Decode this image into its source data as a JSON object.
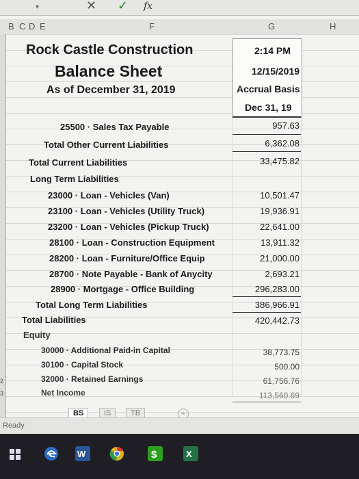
{
  "formula_bar": {
    "fx": "fx"
  },
  "columns": [
    "B",
    "C",
    "D",
    "E",
    "F",
    "G",
    "H"
  ],
  "report": {
    "company": "Rock Castle Construction",
    "title": "Balance Sheet",
    "as_of": "As of December 31, 2019",
    "time": "2:14 PM",
    "date": "12/15/2019",
    "basis": "Accrual Basis",
    "column_header": "Dec 31, 19"
  },
  "rows": [
    {
      "label": "25500 · Sales Tax Payable",
      "value": "957.63"
    },
    {
      "label": "Total Other Current Liabilities",
      "value": "6,362.08"
    },
    {
      "label": "Total Current Liabilities",
      "value": "33,475.82"
    },
    {
      "label": "Long Term Liabilities",
      "value": ""
    },
    {
      "label": "23000 · Loan - Vehicles (Van)",
      "value": "10,501.47"
    },
    {
      "label": "23100 · Loan - Vehicles (Utility Truck)",
      "value": "19,936.91"
    },
    {
      "label": "23200 · Loan - Vehicles (Pickup Truck)",
      "value": "22,641.00"
    },
    {
      "label": "28100 · Loan - Construction Equipment",
      "value": "13,911.32"
    },
    {
      "label": "28200 · Loan - Furniture/Office Equip",
      "value": "21,000.00"
    },
    {
      "label": "28700 · Note Payable - Bank of Anycity",
      "value": "2,693.21"
    },
    {
      "label": "28900 · Mortgage - Office Building",
      "value": "296,283.00"
    },
    {
      "label": "Total Long Term Liabilities",
      "value": "386,966.91"
    },
    {
      "label": "Total Liabilities",
      "value": "420,442.73"
    },
    {
      "label": "Equity",
      "value": ""
    },
    {
      "label": "30000 · Additional Paid-in Capital",
      "value": "38,773.75"
    },
    {
      "label": "30100 · Capital Stock",
      "value": "500.00"
    },
    {
      "label": "32000 · Retained Earnings",
      "value": "61,756.76"
    },
    {
      "label": "Net Income",
      "value": "113,560.69"
    }
  ],
  "row_numbers": [
    "2",
    "3"
  ],
  "sheet_tabs": [
    "BS",
    "IS",
    "TB"
  ],
  "status": "Ready",
  "colors": {
    "taskbar": "#1e1e24",
    "edge_blue": "#2b6cc4",
    "word_blue": "#2a5699",
    "chrome": "#e0b020",
    "quickbooks_green": "#2ca01c",
    "excel_green": "#217346"
  }
}
